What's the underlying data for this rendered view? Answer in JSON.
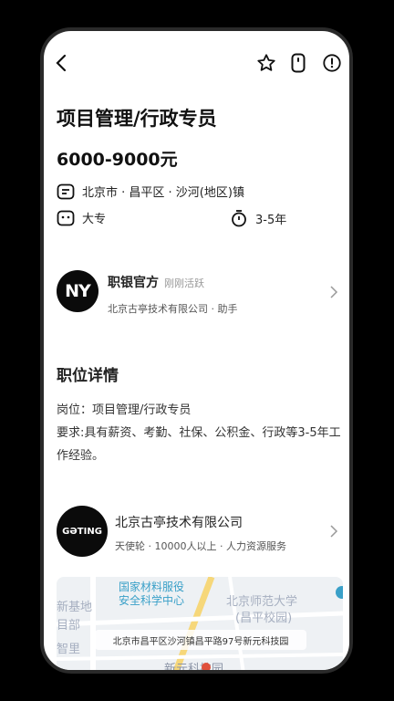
{
  "job": {
    "title": "项目管理/行政专员",
    "salary": "6000-9000元",
    "location": "北京市 · 昌平区 · 沙河(地区)镇",
    "education": "大专",
    "experience": "3-5年"
  },
  "recruiter": {
    "avatar_text": "NY",
    "name": "职银官方",
    "status": "刚刚活跃",
    "subtitle": "北京古亭技术有限公司 · 助手"
  },
  "details": {
    "section_title": "职位详情",
    "line1": "岗位：项目管理/行政专员",
    "line2": "要求:具有薪资、考勤、社保、公积金、行政等3-5年工作经验。"
  },
  "company": {
    "logo_text": "GƏTING",
    "name": "北京古亭技术有限公司",
    "subtitle": "天使轮 · 10000人以上 · 人力资源服务"
  },
  "map": {
    "labels": [
      "新基地",
      "目部",
      "智里",
      "北京师范大学",
      "(昌平校园)",
      "新元科技园"
    ],
    "poi": "国家材料服役安全科学中心",
    "poi_line1": "国家材料服役",
    "poi_line2": "安全科学中心",
    "address": "北京市昌平区沙河镇昌平路97号新元科技园"
  },
  "colors": {
    "accent": "#111111",
    "map_poi": "#3aa0c8"
  }
}
